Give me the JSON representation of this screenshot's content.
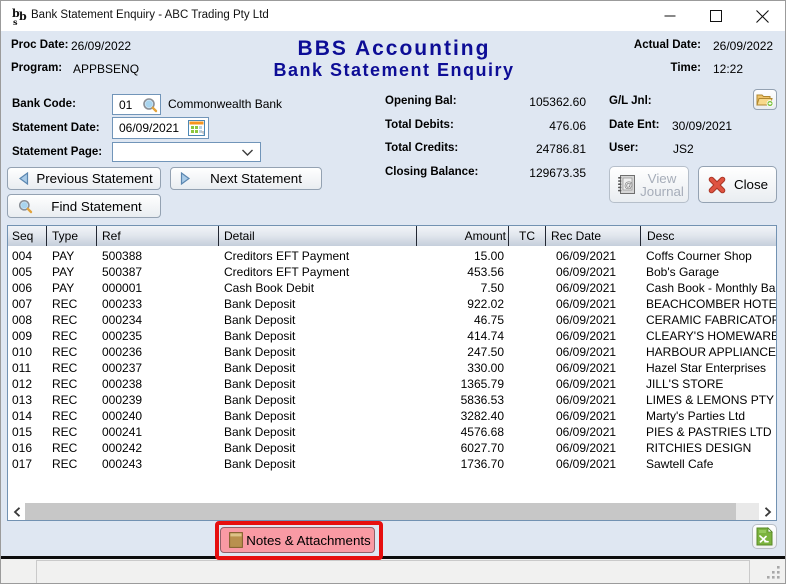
{
  "window": {
    "title": "Bank Statement Enquiry - ABC Trading Pty Ltd"
  },
  "header": {
    "proc_date_label": "Proc Date:",
    "proc_date": "26/09/2022",
    "program_label": "Program:",
    "program": "APPBSENQ",
    "app_title": "BBS Accounting",
    "screen_title": "Bank Statement Enquiry",
    "actual_date_label": "Actual Date:",
    "actual_date": "26/09/2022",
    "time_label": "Time:",
    "time": "12:22"
  },
  "form": {
    "bank_code_label": "Bank Code:",
    "bank_code": "01",
    "bank_name": "Commonwealth Bank",
    "statement_date_label": "Statement Date:",
    "statement_date": "06/09/2021",
    "statement_page_label": "Statement Page:",
    "statement_page": "",
    "previous_button": "Previous Statement",
    "next_button": "Next Statement",
    "find_button": "Find Statement"
  },
  "summary": {
    "rows": [
      {
        "label": "Opening Bal:",
        "value": "105362.60"
      },
      {
        "label": "Total Debits:",
        "value": "476.06"
      },
      {
        "label": "Total Credits:",
        "value": "24786.81"
      },
      {
        "label": "Closing Balance:",
        "value": "129673.35"
      }
    ]
  },
  "journal": {
    "gl_jnl_label": "G/L Jnl:",
    "date_ent_label": "Date Ent:",
    "date_ent": "30/09/2021",
    "user_label": "User:",
    "user": "JS2",
    "view_journal_line1": "View",
    "view_journal_line2": "Journal",
    "close_label": "Close"
  },
  "table": {
    "columns": [
      "Seq",
      "Type",
      "Ref",
      "Detail",
      "Amount",
      "TC",
      "Rec Date",
      "Desc"
    ],
    "rows": [
      [
        "004",
        "PAY",
        "500388",
        "Creditors EFT Payment",
        "15.00",
        "",
        "06/09/2021",
        "Coffs Courner Shop"
      ],
      [
        "005",
        "PAY",
        "500387",
        "Creditors EFT Payment",
        "453.56",
        "",
        "06/09/2021",
        "Bob's Garage"
      ],
      [
        "006",
        "PAY",
        "000001",
        "Cash Book Debit",
        "7.50",
        "",
        "06/09/2021",
        "Cash Book - Monthly Bank Charges"
      ],
      [
        "007",
        "REC",
        "000233",
        "Bank Deposit",
        "922.02",
        "",
        "06/09/2021",
        "BEACHCOMBER HOTEL"
      ],
      [
        "008",
        "REC",
        "000234",
        "Bank Deposit",
        "46.75",
        "",
        "06/09/2021",
        "CERAMIC FABRICATORS"
      ],
      [
        "009",
        "REC",
        "000235",
        "Bank Deposit",
        "414.74",
        "",
        "06/09/2021",
        "CLEARY'S HOMEWARES"
      ],
      [
        "010",
        "REC",
        "000236",
        "Bank Deposit",
        "247.50",
        "",
        "06/09/2021",
        "HARBOUR APPLIANCES"
      ],
      [
        "011",
        "REC",
        "000237",
        "Bank Deposit",
        "330.00",
        "",
        "06/09/2021",
        "Hazel Star Enterprises"
      ],
      [
        "012",
        "REC",
        "000238",
        "Bank Deposit",
        "1365.79",
        "",
        "06/09/2021",
        "JILL'S STORE"
      ],
      [
        "013",
        "REC",
        "000239",
        "Bank Deposit",
        "5836.53",
        "",
        "06/09/2021",
        "LIMES & LEMONS PTY LTD"
      ],
      [
        "014",
        "REC",
        "000240",
        "Bank Deposit",
        "3282.40",
        "",
        "06/09/2021",
        "Marty's Parties Ltd"
      ],
      [
        "015",
        "REC",
        "000241",
        "Bank Deposit",
        "4576.68",
        "",
        "06/09/2021",
        "PIES & PASTRIES LTD"
      ],
      [
        "016",
        "REC",
        "000242",
        "Bank Deposit",
        "6027.70",
        "",
        "06/09/2021",
        "RITCHIES DESIGN"
      ],
      [
        "017",
        "REC",
        "000243",
        "Bank Deposit",
        "1736.70",
        "",
        "06/09/2021",
        "Sawtell Cafe"
      ]
    ]
  },
  "footer": {
    "notes_button_label": "Notes & Attachments"
  },
  "colors": {
    "content_bg": "#dfe7f2",
    "title_navy": "#0d0d96",
    "annotation_red": "#e60f0f",
    "notes_pink": "#f99aa4"
  }
}
